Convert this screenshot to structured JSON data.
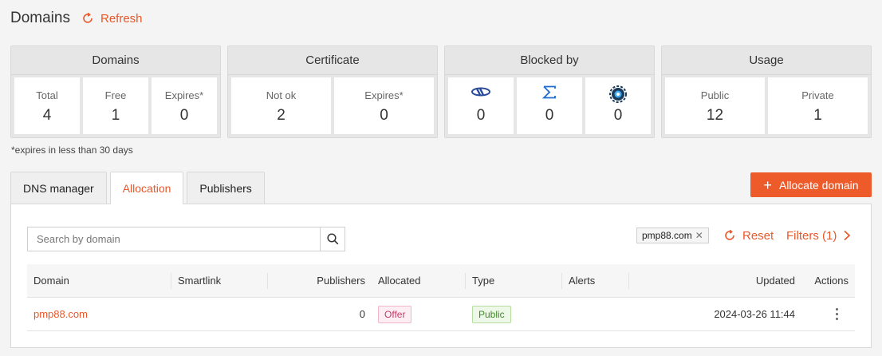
{
  "header": {
    "title": "Domains",
    "refresh_label": "Refresh"
  },
  "colors": {
    "accent": "#ee5b2b",
    "offer_badge": "#c83a6b",
    "public_badge": "#3f8a25"
  },
  "cards": {
    "domains": {
      "title": "Domains",
      "stats": [
        {
          "label": "Total",
          "value": "4"
        },
        {
          "label": "Free",
          "value": "1"
        },
        {
          "label": "Expires*",
          "value": "0"
        }
      ]
    },
    "certificate": {
      "title": "Certificate",
      "stats": [
        {
          "label": "Not ok",
          "value": "2"
        },
        {
          "label": "Expires*",
          "value": "0"
        }
      ]
    },
    "blocked": {
      "title": "Blocked by",
      "stats": [
        {
          "icon": "network-blocker-logo-icon",
          "value": "0"
        },
        {
          "icon": "sigma-blocker-icon",
          "value": "0"
        },
        {
          "icon": "gear-at-blocker-icon",
          "value": "0"
        }
      ]
    },
    "usage": {
      "title": "Usage",
      "stats": [
        {
          "label": "Public",
          "value": "12"
        },
        {
          "label": "Private",
          "value": "1"
        }
      ]
    }
  },
  "footnote": "*expires in less than 30 days",
  "tabs": [
    {
      "label": "DNS manager",
      "active": false
    },
    {
      "label": "Allocation",
      "active": true
    },
    {
      "label": "Publishers",
      "active": false
    }
  ],
  "allocate_button": {
    "label": "Allocate domain",
    "icon": "plus-icon"
  },
  "search": {
    "placeholder": "Search by domain",
    "value": ""
  },
  "filters": {
    "chip": "pmp88.com",
    "reset_label": "Reset",
    "filters_label": "Filters (1)"
  },
  "table": {
    "columns": [
      "Domain",
      "Smartlink",
      "Publishers",
      "Allocated",
      "Type",
      "Alerts",
      "Updated",
      "Actions"
    ],
    "rows": [
      {
        "domain": "pmp88.com",
        "smartlink": "",
        "publishers": "0",
        "allocated": "Offer",
        "type": "Public",
        "alerts": "",
        "updated": "2024-03-26 11:44"
      }
    ]
  }
}
